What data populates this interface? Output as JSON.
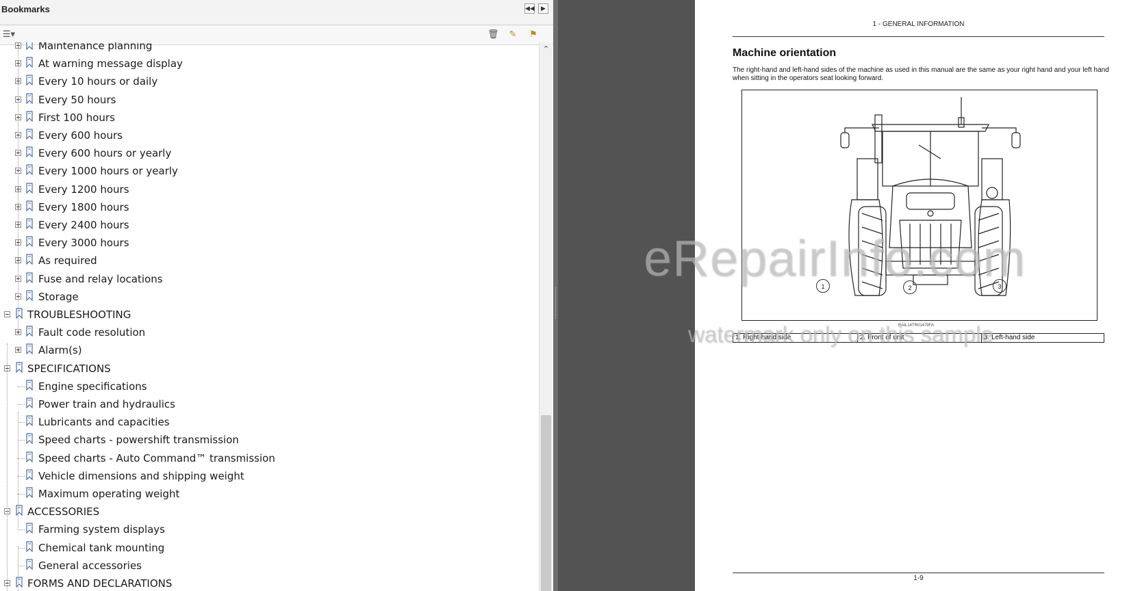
{
  "bookmarks_panel": {
    "title": "Bookmarks",
    "items": [
      {
        "label": "Maintenance planning",
        "level": 2,
        "toggle": "plus"
      },
      {
        "label": "At warning message display",
        "level": 2,
        "toggle": "plus"
      },
      {
        "label": "Every 10 hours or daily",
        "level": 2,
        "toggle": "plus"
      },
      {
        "label": "Every 50 hours",
        "level": 2,
        "toggle": "plus"
      },
      {
        "label": "First 100 hours",
        "level": 2,
        "toggle": "plus"
      },
      {
        "label": "Every 600 hours",
        "level": 2,
        "toggle": "plus"
      },
      {
        "label": "Every 600 hours or yearly",
        "level": 2,
        "toggle": "plus"
      },
      {
        "label": "Every 1000 hours or yearly",
        "level": 2,
        "toggle": "plus"
      },
      {
        "label": "Every 1200 hours",
        "level": 2,
        "toggle": "plus"
      },
      {
        "label": "Every 1800 hours",
        "level": 2,
        "toggle": "plus"
      },
      {
        "label": "Every 2400 hours",
        "level": 2,
        "toggle": "plus"
      },
      {
        "label": "Every 3000 hours",
        "level": 2,
        "toggle": "plus"
      },
      {
        "label": "As required",
        "level": 2,
        "toggle": "plus"
      },
      {
        "label": "Fuse and relay locations",
        "level": 2,
        "toggle": "plus"
      },
      {
        "label": "Storage",
        "level": 2,
        "toggle": "plus"
      },
      {
        "label": "TROUBLESHOOTING",
        "level": 1,
        "toggle": "minus"
      },
      {
        "label": "Fault code resolution",
        "level": 2,
        "toggle": "plus"
      },
      {
        "label": "Alarm(s)",
        "level": 2,
        "toggle": "plus"
      },
      {
        "label": "SPECIFICATIONS",
        "level": 1,
        "toggle": "minus"
      },
      {
        "label": "Engine specifications",
        "level": 2,
        "toggle": "none"
      },
      {
        "label": "Power train and hydraulics",
        "level": 2,
        "toggle": "none"
      },
      {
        "label": "Lubricants and capacities",
        "level": 2,
        "toggle": "none"
      },
      {
        "label": "Speed charts - powershift transmission",
        "level": 2,
        "toggle": "none"
      },
      {
        "label": "Speed charts - Auto Command™ transmission",
        "level": 2,
        "toggle": "none"
      },
      {
        "label": "Vehicle dimensions and shipping weight",
        "level": 2,
        "toggle": "none"
      },
      {
        "label": "Maximum operating weight",
        "level": 2,
        "toggle": "none"
      },
      {
        "label": "ACCESSORIES",
        "level": 1,
        "toggle": "minus"
      },
      {
        "label": "Farming system displays",
        "level": 2,
        "toggle": "none"
      },
      {
        "label": "Chemical tank mounting",
        "level": 2,
        "toggle": "none"
      },
      {
        "label": "General accessories",
        "level": 2,
        "toggle": "none"
      },
      {
        "label": "FORMS AND DECLARATIONS",
        "level": 1,
        "toggle": "minus"
      }
    ]
  },
  "document": {
    "section_header": "1 - GENERAL INFORMATION",
    "title": "Machine orientation",
    "paragraph": "The right-hand and left-hand sides of the machine as used in this manual are the same as your right hand and your left hand when sitting in the operators seat looking forward.",
    "figure_code": "RAIL14TR01479FA",
    "callouts": [
      "1",
      "2",
      "3"
    ],
    "legend": [
      "1.  Right-hand side",
      "2.  Front of unit",
      "3.  Left-hand side"
    ],
    "page_number": "1-9"
  },
  "watermark": {
    "line1": "eRepairInfo.com",
    "line2": "watermark only on this sample"
  },
  "colors": {
    "gray_background": "#535353",
    "bookmark_icon": "#4a6ea8"
  }
}
